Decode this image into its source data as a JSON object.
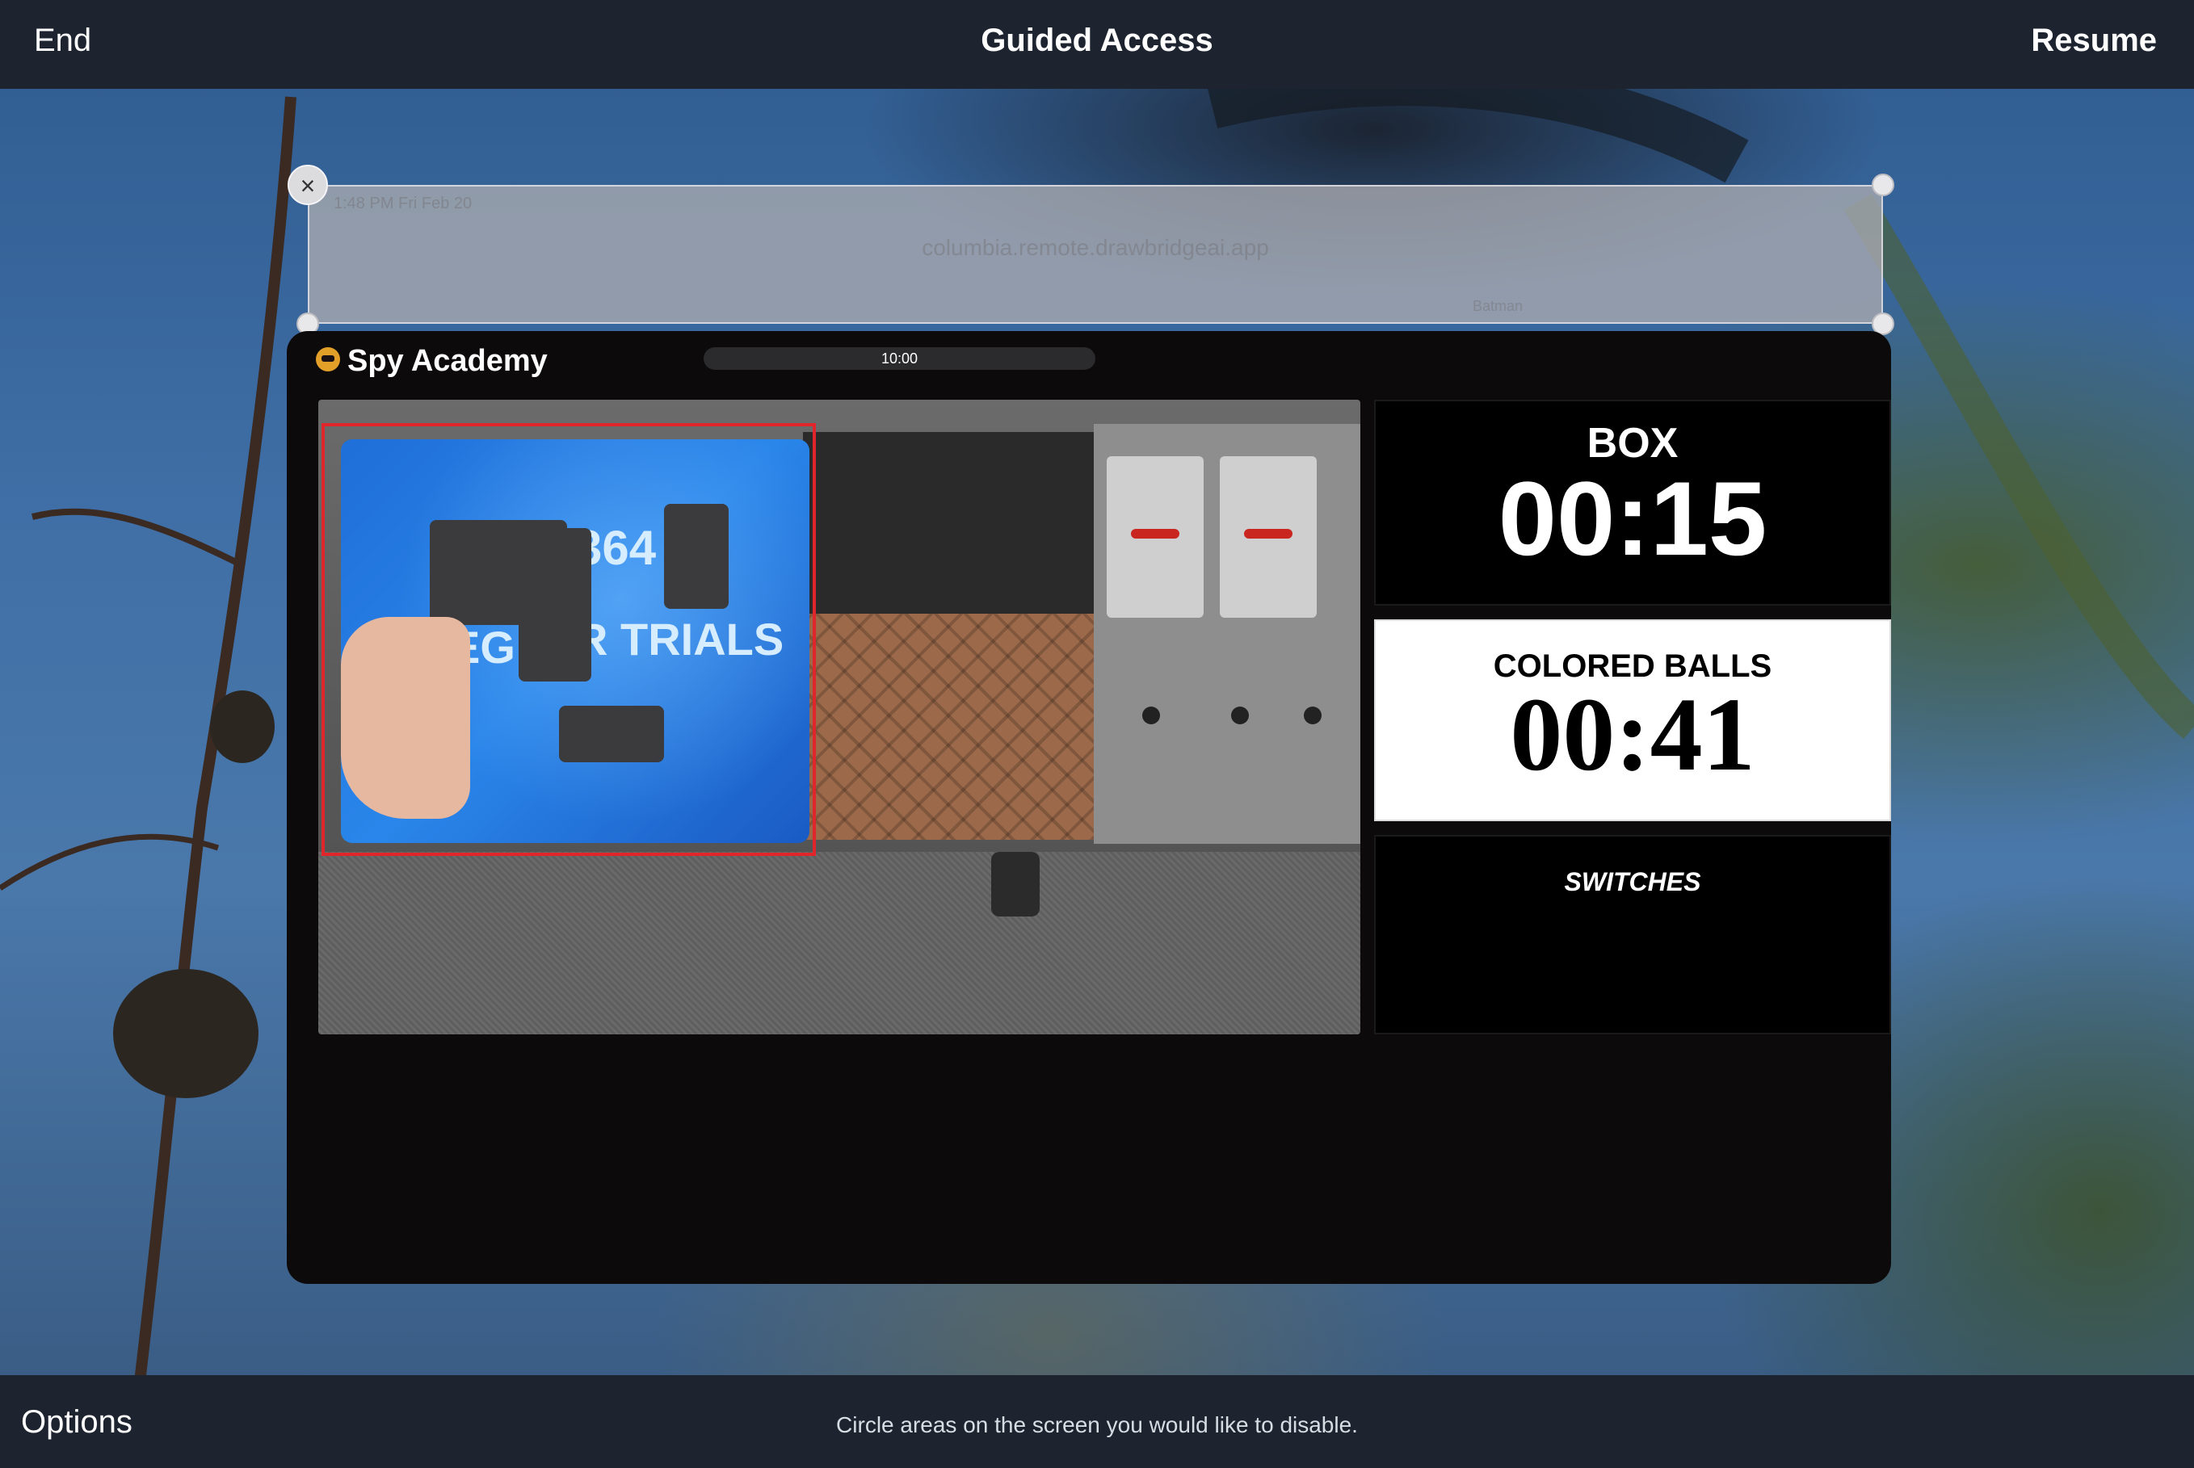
{
  "topbar": {
    "end_label": "End",
    "title": "Guided Access",
    "resume_label": "Resume"
  },
  "bottombar": {
    "options_label": "Options",
    "hint": "Circle areas on the screen you would like to disable."
  },
  "disabled_region": {
    "status_text": "1:48 PM   Fri Feb 20",
    "url": "columbia.remote.drawbridgeai.app",
    "tab_right": "Batman",
    "close_glyph": "×"
  },
  "app": {
    "title": "Spy Academy",
    "logo_icon": "spy-logo-icon",
    "timer": "10:00",
    "camera": {
      "puzzle_text_1": "364",
      "puzzle_text_2": "R TRIALS",
      "puzzle_text_3": "EG"
    },
    "tiles": [
      {
        "label": "BOX",
        "time": "00:15"
      },
      {
        "label": "COLORED BALLS",
        "time": "00:41"
      },
      {
        "label": "SWITCHES"
      }
    ]
  },
  "colors": {
    "bar_bg": "#1d2430",
    "app_bg": "#0d0a0b",
    "highlight": "#e0262a",
    "logo": "#e3a028"
  }
}
